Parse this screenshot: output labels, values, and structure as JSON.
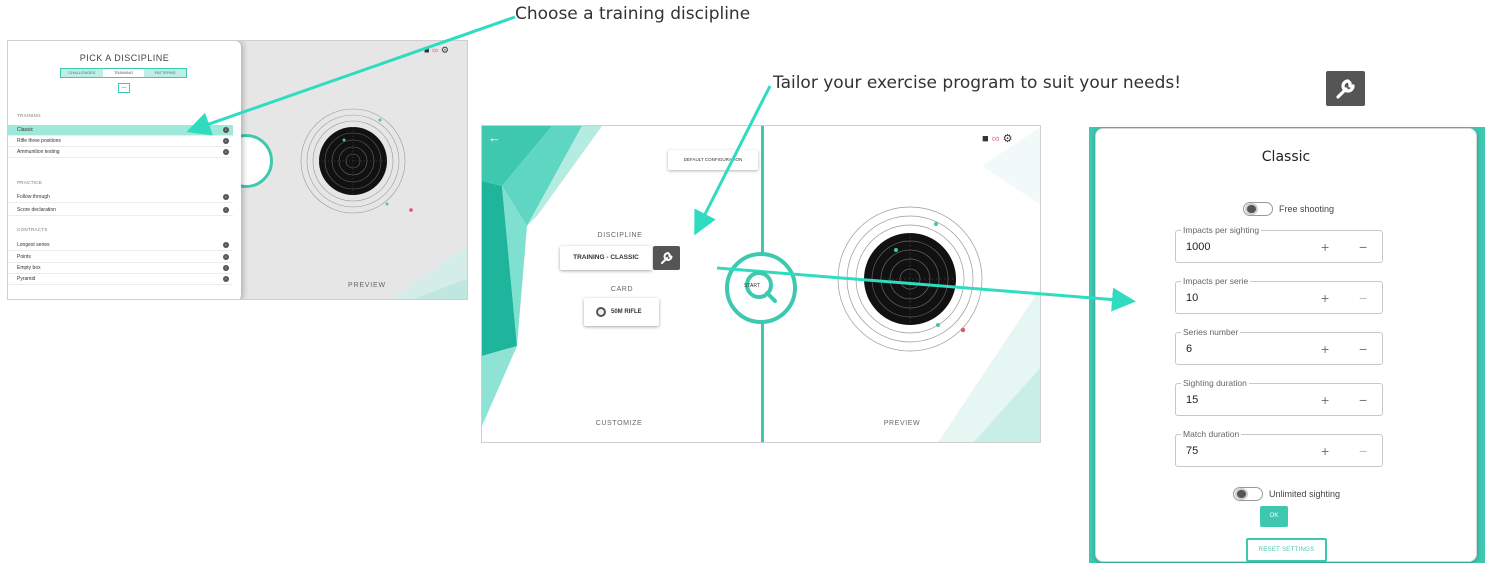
{
  "callouts": {
    "choose": "Choose a training discipline",
    "tailor": "Tailor your exercise program to suit your needs!"
  },
  "colors": {
    "accent": "#3ec8b0",
    "dark": "#555555",
    "arrow": "#2fdcbf",
    "target_black": "#111111",
    "shot_red": "#e05565"
  },
  "picker": {
    "title": "PICK A DISCIPLINE",
    "tabs": [
      "CHALLENGES",
      "TRAINING",
      "PATTERNS"
    ],
    "active_tab": "TRAINING",
    "sections": [
      {
        "name": "TRAINING",
        "items": [
          "Classic",
          "Rifle three positions",
          "Ammunition testing"
        ]
      },
      {
        "name": "PRACTICE",
        "items": [
          "Follow through",
          "Score declaration"
        ]
      },
      {
        "name": "CONTRACTS",
        "items": [
          "Longest series",
          "Points",
          "Empty box",
          "Pyramid"
        ]
      }
    ],
    "selected_item": "Classic",
    "preview_label": "PREVIEW"
  },
  "customize": {
    "default_button": "DEFAULT CONFIGURATION",
    "discipline_label": "DISCIPLINE",
    "discipline_value": "TRAINING - CLASSIC",
    "card_label": "CARD",
    "card_value": "50M RIFLE",
    "start_label": "START",
    "customize_label": "CUSTOMIZE",
    "preview_label": "PREVIEW"
  },
  "classic_dialog": {
    "title": "Classic",
    "free_shooting": "Free shooting",
    "fields": [
      {
        "label": "Impacts per sighting",
        "value": "1000"
      },
      {
        "label": "Impacts per serie",
        "value": "10"
      },
      {
        "label": "Series number",
        "value": "6"
      },
      {
        "label": "Sighting duration",
        "value": "15"
      },
      {
        "label": "Match duration",
        "value": "75"
      }
    ],
    "plus": "+",
    "minus": "−",
    "unlimited_sighting": "Unlimited sighting",
    "ok": "OK",
    "reset": "RESET SETTINGS"
  },
  "icons": [
    "back-arrow-icon",
    "lock-icon",
    "binoculars-icon",
    "gear-icon",
    "wrench-icon",
    "target-icon",
    "info-icon"
  ]
}
